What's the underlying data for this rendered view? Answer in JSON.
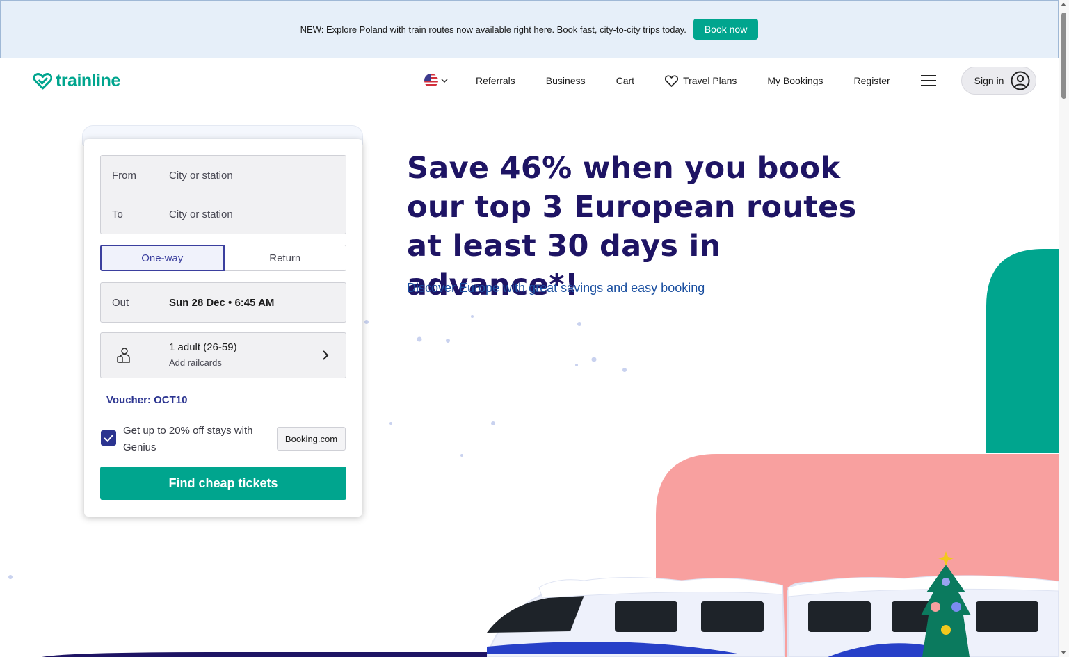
{
  "banner": {
    "text": "NEW: Explore Poland with train routes now available right here. Book fast, city-to-city trips today.",
    "button_label": "Book now"
  },
  "header": {
    "logo_text": "trainline",
    "locale_icon": "us-flag-icon",
    "nav": {
      "referrals": "Referrals",
      "business": "Business",
      "cart": "Cart",
      "travel_plans": "Travel Plans",
      "my_bookings": "My Bookings",
      "register": "Register"
    },
    "signin_label": "Sign in"
  },
  "search": {
    "from_label": "From",
    "from_placeholder": "City or station",
    "to_label": "To",
    "to_placeholder": "City or station",
    "trip_types": [
      "One-way",
      "Return"
    ],
    "selected_trip_type": "One-way",
    "out_label": "Out",
    "out_value": "Sun 28 Dec • 6:45 AM",
    "passengers": "1 adult (26-59)",
    "railcards_label": "Add railcards",
    "voucher": "Voucher: OCT10",
    "genius_text": "Get up to 20% off stays with Genius",
    "genius_checked": true,
    "partner_badge": "Booking.com",
    "submit_label": "Find cheap tickets"
  },
  "hero": {
    "title": "Save 46% when you book our top 3 European routes at least 30 days in advance*!",
    "subtitle": "Discover Europe with great savings and easy booking"
  },
  "colors": {
    "brand_green": "#00a58e",
    "brand_navy": "#1e1464",
    "accent_blue": "#2b3490",
    "banner_bg": "#e6eff9",
    "illustration_pink": "#f8a09f"
  }
}
